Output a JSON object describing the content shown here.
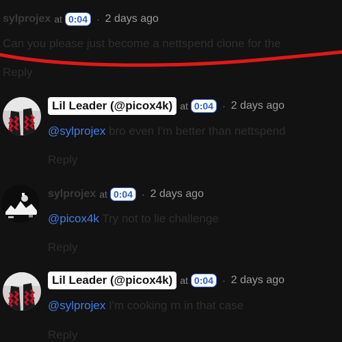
{
  "top_comment": {
    "author": "sylprojex",
    "at_label": "at",
    "timestamp": "0:04",
    "separator": "·",
    "time_ago": "2 days ago",
    "text": "Can you please just become a nettspend clone for the",
    "reply_label": "Reply"
  },
  "replies": [
    {
      "author": "Lil Leader (@picox4k)",
      "at_label": "at",
      "timestamp": "0:04",
      "separator": "·",
      "time_ago": "2 days ago",
      "mention": "@sylprojex",
      "text": " bro even I'm better than nettspend",
      "reply_label": "Reply"
    },
    {
      "author": "sylprojex",
      "at_label": "at",
      "timestamp": "0:04",
      "separator": "·",
      "time_ago": "2 days ago",
      "mention": "@picox4k",
      "text": " Try not to lie challenge",
      "reply_label": "Reply"
    },
    {
      "author": "Lil Leader (@picox4k)",
      "at_label": "at",
      "timestamp": "0:04",
      "separator": "·",
      "time_ago": "2 days ago",
      "mention": "@sylprojex",
      "text": " I'm cooking rn in that case",
      "reply_label": "Reply"
    }
  ],
  "colors": {
    "background": "#121212",
    "mention": "#3f7ee8",
    "timestamp_text": "#2a5fc7",
    "annotation_stroke": "#e01818"
  },
  "icons": {
    "avatar_lil_leader": "red-black-checkered-boots-avatar",
    "avatar_sylprojex": "black-white-noise-avatar"
  }
}
